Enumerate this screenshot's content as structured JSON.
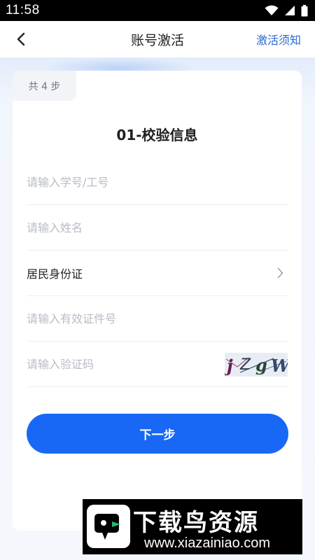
{
  "status_bar": {
    "time": "11:58"
  },
  "nav": {
    "title": "账号激活",
    "link": "激活须知"
  },
  "card": {
    "step_badge": "共 4 步",
    "title": "01-校验信息",
    "fields": {
      "student_id_placeholder": "请输入学号/工号",
      "name_placeholder": "请输入姓名",
      "id_type_value": "居民身份证",
      "id_number_placeholder": "请输入有效证件号",
      "captcha_placeholder": "请输入验证码"
    },
    "captcha_text": "jZgW",
    "next_button": "下一步"
  },
  "watermark": {
    "title": "下载鸟资源",
    "url": "www.xiazainiao.com"
  },
  "colors": {
    "primary": "#1868f5",
    "link": "#2a67d8",
    "status_bar": "#000000"
  }
}
